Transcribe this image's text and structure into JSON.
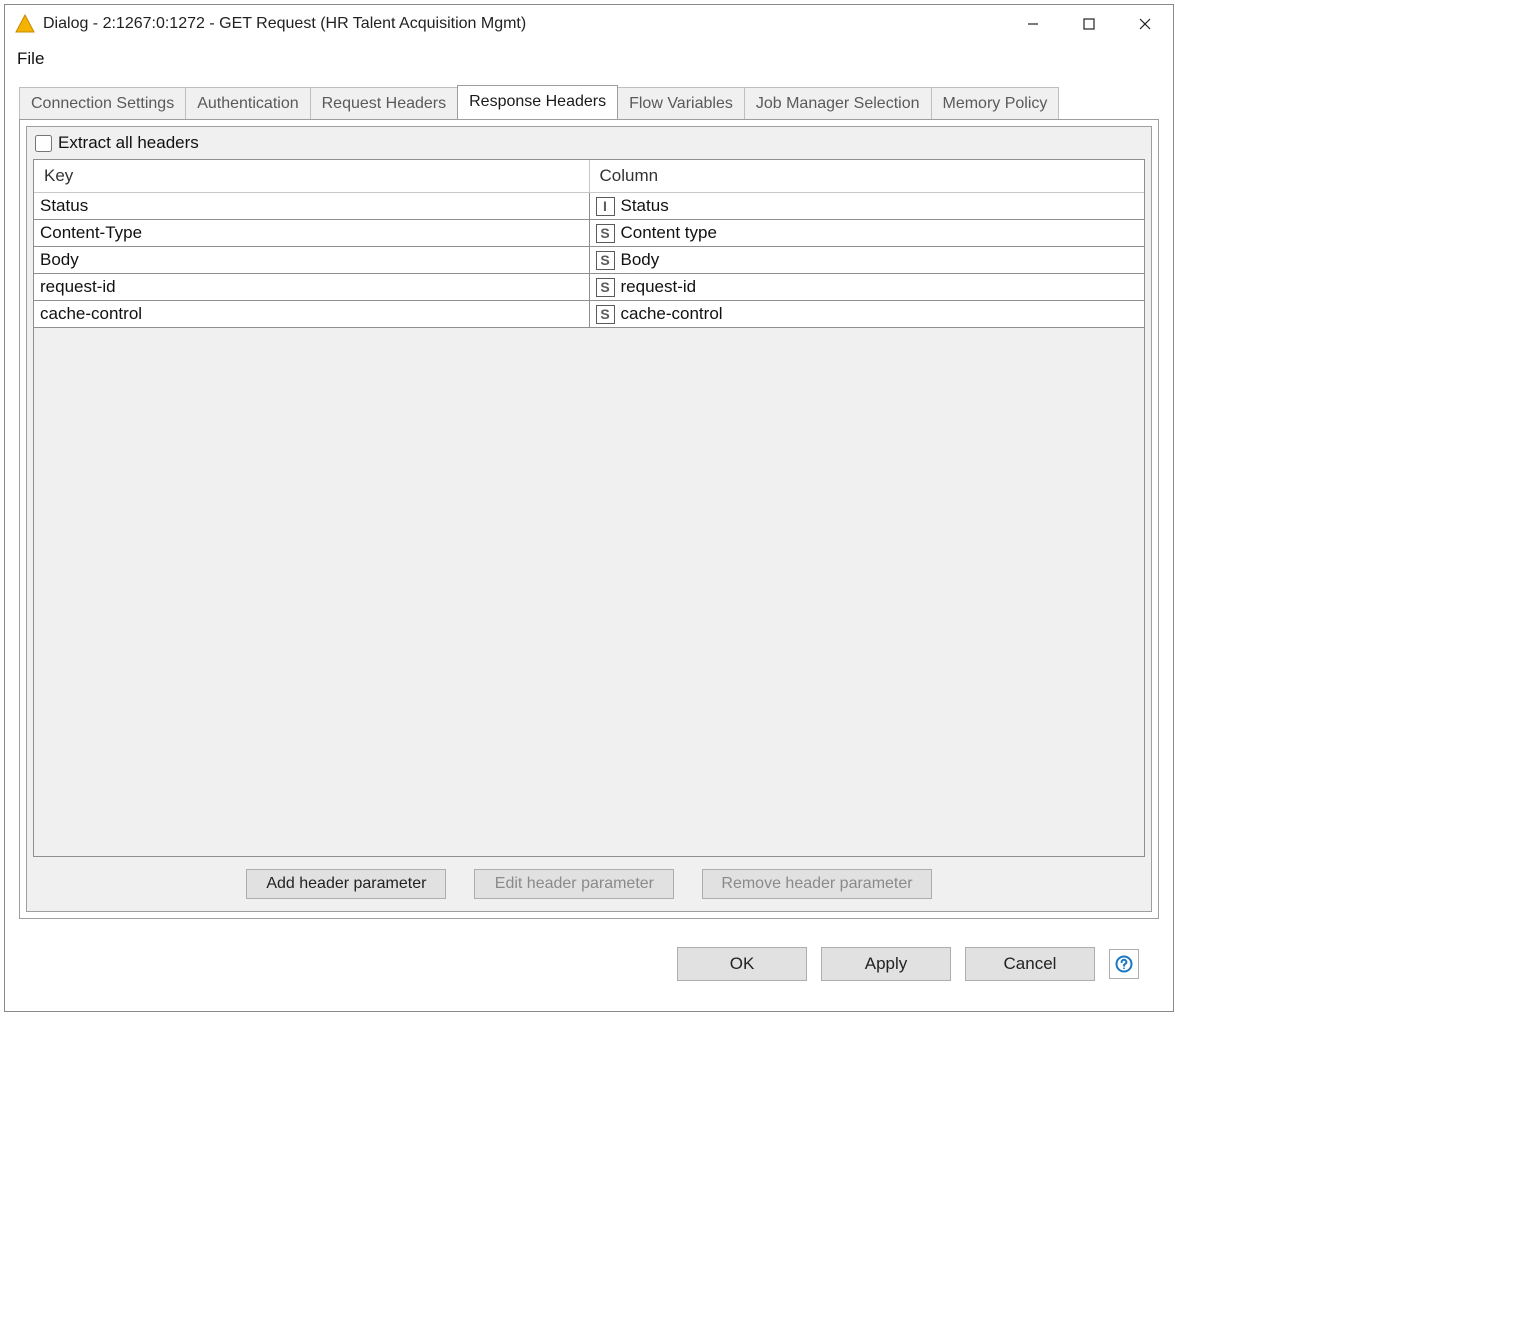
{
  "window": {
    "title": "Dialog - 2:1267:0:1272 - GET Request (HR Talent Acquisition Mgmt)"
  },
  "menubar": {
    "file": "File"
  },
  "tabs": [
    {
      "label": "Connection Settings",
      "active": false
    },
    {
      "label": "Authentication",
      "active": false
    },
    {
      "label": "Request Headers",
      "active": false
    },
    {
      "label": "Response Headers",
      "active": true
    },
    {
      "label": "Flow Variables",
      "active": false
    },
    {
      "label": "Job Manager Selection",
      "active": false
    },
    {
      "label": "Memory Policy",
      "active": false
    }
  ],
  "response_headers_panel": {
    "extract_all_label": "Extract all headers",
    "extract_all_checked": false,
    "columns": {
      "key": "Key",
      "column": "Column"
    },
    "rows": [
      {
        "key": "Status",
        "type": "I",
        "column": "Status"
      },
      {
        "key": "Content-Type",
        "type": "S",
        "column": "Content type"
      },
      {
        "key": "Body",
        "type": "S",
        "column": "Body"
      },
      {
        "key": "request-id",
        "type": "S",
        "column": "request-id"
      },
      {
        "key": "cache-control",
        "type": "S",
        "column": "cache-control"
      }
    ],
    "actions": {
      "add": "Add header parameter",
      "edit": "Edit header parameter",
      "remove": "Remove header parameter"
    }
  },
  "footer": {
    "ok": "OK",
    "apply": "Apply",
    "cancel": "Cancel"
  }
}
